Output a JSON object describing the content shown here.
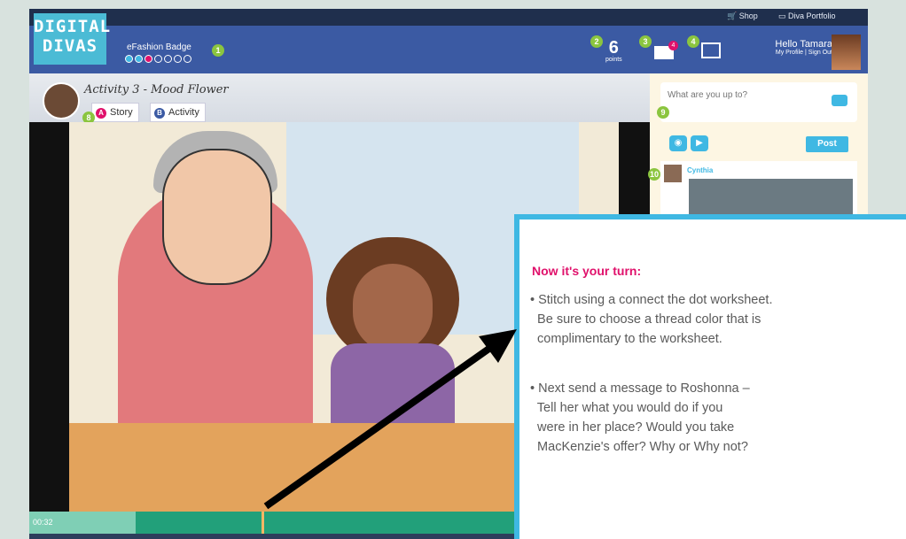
{
  "app": {
    "logo_line1": "DIGITAL",
    "logo_line2": "DIVAS"
  },
  "topnav": {
    "shop": "Shop",
    "portfolio": "Diva Portfolio"
  },
  "badge": {
    "title": "eFashion Badge",
    "progress_done": 3,
    "progress_total": 7
  },
  "header": {
    "points_value": "6",
    "points_label": "points",
    "mail_count": "4",
    "greeting": "Hello Tamara",
    "profile": "My Profile",
    "signout": "Sign Out"
  },
  "callouts": [
    "1",
    "2",
    "3",
    "4",
    "8",
    "9",
    "10"
  ],
  "activity": {
    "title": "Activity 3 - Mood Flower",
    "tabs": [
      {
        "key": "A",
        "label": "Story"
      },
      {
        "key": "B",
        "label": "Activity"
      }
    ]
  },
  "video": {
    "time": "00:32",
    "progress": 0.38
  },
  "sidebar": {
    "status_placeholder": "What are you up to?",
    "post_label": "Post",
    "feed_name": "Cynthia"
  },
  "popup": {
    "title": "Now it's your turn:",
    "bullets": [
      "• Stitch using a connect the dot worksheet.\n  Be sure to choose a thread color that is\n  complimentary to the worksheet.",
      "• Next send a message to Roshonna –\n  Tell her what you would do if you\n  were in her place? Would you take\n  MacKenzie's offer? Why or Why not?"
    ]
  },
  "colors": {
    "nav": "#1f2f4d",
    "badgebar": "#3b5aa3",
    "accent": "#3fb8e3",
    "callout": "#8bc53f",
    "popup_title": "#e0116b",
    "timeline": "#22a07a"
  }
}
